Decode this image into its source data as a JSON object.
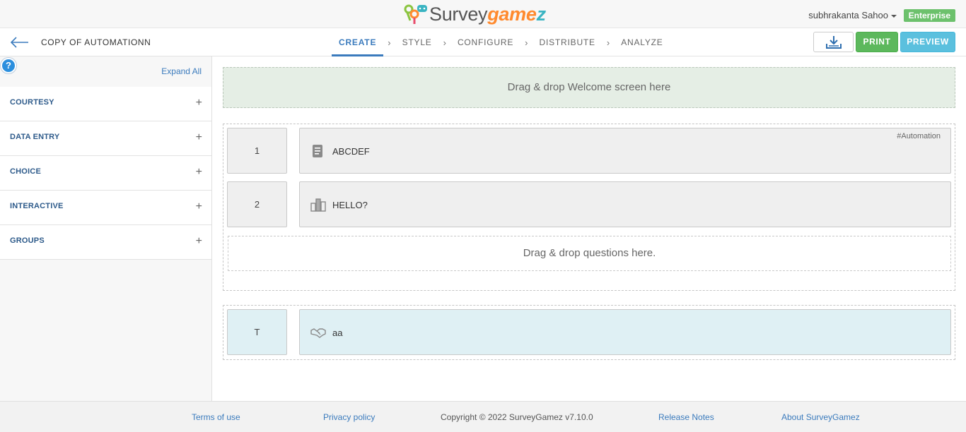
{
  "header": {
    "logo_main": "Survey",
    "logo_accent": "game",
    "logo_accent_end": "z",
    "user_name": "subhrakanta Sahoo",
    "plan_badge": "Enterprise"
  },
  "nav": {
    "survey_name": "COPY OF AUTOMATIONN",
    "steps": [
      {
        "label": "CREATE",
        "active": true
      },
      {
        "label": "STYLE"
      },
      {
        "label": "CONFIGURE"
      },
      {
        "label": "DISTRIBUTE"
      },
      {
        "label": "ANALYZE"
      }
    ],
    "print_label": "PRINT",
    "preview_label": "PREVIEW",
    "download_icon": "download-tray-icon",
    "back_icon": "arrow-left-icon"
  },
  "sidebar": {
    "help_label": "?",
    "expand_all": "Expand All",
    "categories": [
      {
        "label": "COURTESY"
      },
      {
        "label": "DATA ENTRY"
      },
      {
        "label": "CHOICE"
      },
      {
        "label": "INTERACTIVE"
      },
      {
        "label": "GROUPS"
      }
    ],
    "expand_symbol": "+"
  },
  "canvas": {
    "welcome_drop": "Drag & drop Welcome screen here",
    "questions": [
      {
        "number": "1",
        "title": "ABCDEF",
        "tag": "#Automation",
        "icon": "document-icon"
      },
      {
        "number": "2",
        "title": "HELLO?",
        "tag": "",
        "icon": "buildings-icon"
      }
    ],
    "questions_drop": "Drag & drop questions here.",
    "thankyou": {
      "number": "T",
      "title": "aa",
      "icon": "handshake-icon"
    }
  },
  "footer": {
    "terms": "Terms of use",
    "privacy": "Privacy policy",
    "copyright": "Copyright ©  2022 SurveyGamez v7.10.0",
    "release_notes": "Release Notes",
    "about": "About SurveyGamez"
  },
  "colors": {
    "accent_blue": "#3b7bbd",
    "print_green": "#5cb85c",
    "preview_cyan": "#5bc0de",
    "badge_green": "#6cc16c",
    "welcome_bg": "#e5eee5",
    "thankyou_bg": "#dff0f4"
  }
}
